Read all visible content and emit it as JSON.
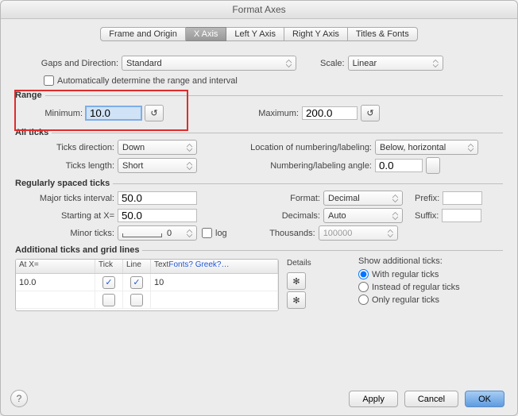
{
  "title": "Format Axes",
  "tabs": [
    "Frame and Origin",
    "X Axis",
    "Left Y Axis",
    "Right Y Axis",
    "Titles & Fonts"
  ],
  "activeTab": 1,
  "gaps": {
    "label": "Gaps and Direction:",
    "value": "Standard"
  },
  "scale": {
    "label": "Scale:",
    "value": "Linear"
  },
  "autoRange": {
    "label": "Automatically determine the range and interval",
    "checked": false
  },
  "sections": {
    "range": "Range",
    "allTicks": "All ticks",
    "regTicks": "Regularly spaced ticks",
    "addlTicks": "Additional ticks and grid lines"
  },
  "range": {
    "minLabel": "Minimum:",
    "minValue": "10.0",
    "minReset": "↺",
    "maxLabel": "Maximum:",
    "maxValue": "200.0",
    "maxReset": "↺"
  },
  "allTicks": {
    "dirLabel": "Ticks direction:",
    "dirValue": "Down",
    "lenLabel": "Ticks length:",
    "lenValue": "Short",
    "locLabel": "Location of numbering/labeling:",
    "locValue": "Below, horizontal",
    "angLabel": "Numbering/labeling angle:",
    "angValue": "0.0"
  },
  "regTicks": {
    "intLabel": "Major ticks interval:",
    "intValue": "50.0",
    "startLabel": "Starting at X=",
    "startValue": "50.0",
    "minorLabel": "Minor ticks:",
    "minorValue": "0",
    "logLabel": "log",
    "fmtLabel": "Format:",
    "fmtValue": "Decimal",
    "decLabel": "Decimals:",
    "decValue": "Auto",
    "thLabel": "Thousands:",
    "thValue": "100000",
    "prefixLabel": "Prefix:",
    "prefixValue": "",
    "suffixLabel": "Suffix:",
    "suffixValue": ""
  },
  "addl": {
    "headers": {
      "atx": "At X=",
      "tick": "Tick",
      "line": "Line",
      "text": "Text"
    },
    "helpLink": "Fonts? Greek?…",
    "detailsLabel": "Details",
    "rows": [
      {
        "atx": "10.0",
        "tick": true,
        "line": true,
        "text": "10"
      },
      {
        "atx": "",
        "tick": false,
        "line": false,
        "text": ""
      }
    ],
    "showLabel": "Show additional ticks:",
    "opts": [
      "With regular ticks",
      "Instead of regular ticks",
      "Only regular ticks"
    ],
    "selected": 0
  },
  "buttons": {
    "apply": "Apply",
    "cancel": "Cancel",
    "ok": "OK",
    "help": "?",
    "gear": "✻"
  }
}
